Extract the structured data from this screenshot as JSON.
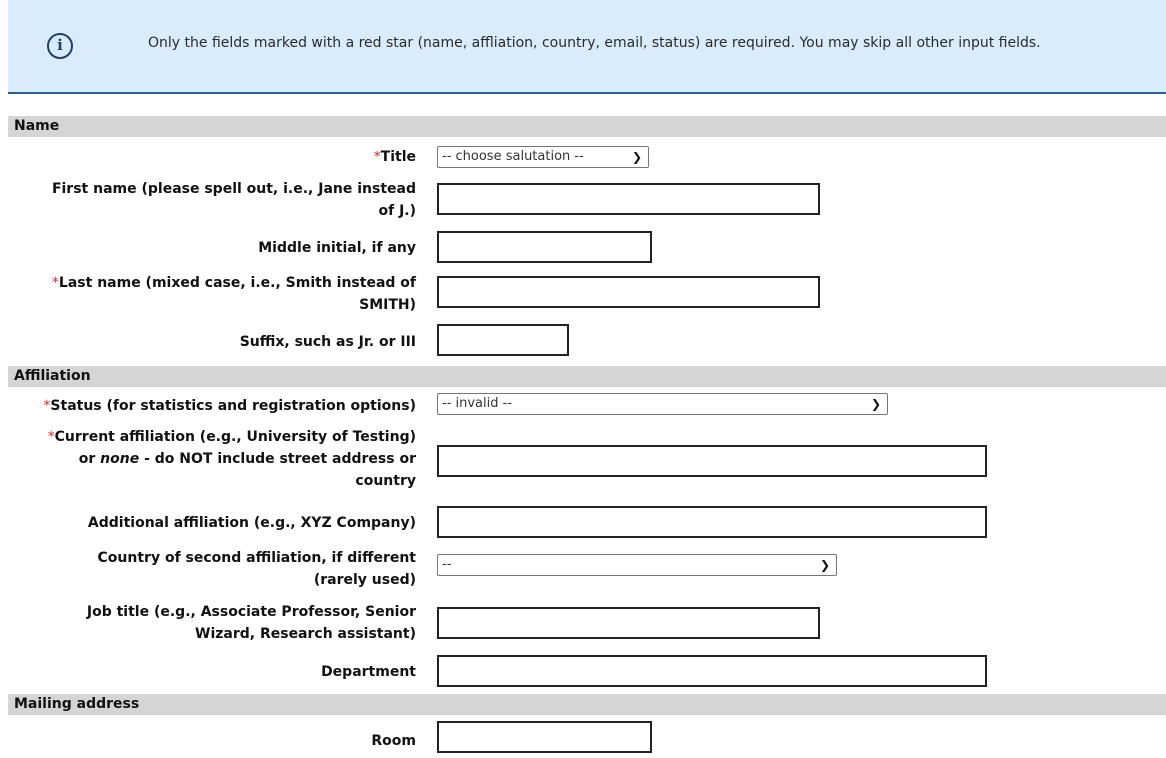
{
  "notice": {
    "icon": "info-circle-icon",
    "text": "Only the fields marked with a red star (name, affliation, country, email, status) are required. You may skip all other input fields."
  },
  "sections": {
    "name": "Name",
    "affiliation": "Affiliation",
    "mailing": "Mailing address"
  },
  "fields": {
    "title": {
      "required": "*",
      "label": "Title",
      "value": "-- choose salutation --"
    },
    "first_name": {
      "label_line1": "First name (please spell out, i.e., Jane instead",
      "label_line2": "of J.)",
      "value": ""
    },
    "middle_initial": {
      "label": "Middle initial, if any",
      "value": ""
    },
    "last_name": {
      "required": "*",
      "label_line1": "Last name (mixed case, i.e., Smith instead of",
      "label_line2": "SMITH)",
      "value": ""
    },
    "suffix": {
      "label": "Suffix, such as Jr. or III",
      "value": ""
    },
    "status": {
      "required": "*",
      "label": "Status (for statistics and registration options)",
      "value": "-- invalid --"
    },
    "current_affiliation": {
      "required": "*",
      "label_line1": "Current affiliation (e.g., University of Testing)",
      "label_line2_pre": "or ",
      "label_line2_em": "none",
      "label_line2_post": " - do NOT include street address or",
      "label_line3": "country",
      "value": ""
    },
    "additional_affiliation": {
      "label": "Additional affiliation (e.g., XYZ Company)",
      "value": ""
    },
    "second_country": {
      "label_line1": "Country of second affiliation, if different",
      "label_line2": "(rarely used)",
      "value": "--"
    },
    "job_title": {
      "label_line1": "Job title (e.g., Associate Professor, Senior",
      "label_line2": "Wizard, Research assistant)",
      "value": ""
    },
    "department": {
      "label": "Department",
      "value": ""
    },
    "room": {
      "label": "Room",
      "value": ""
    }
  }
}
